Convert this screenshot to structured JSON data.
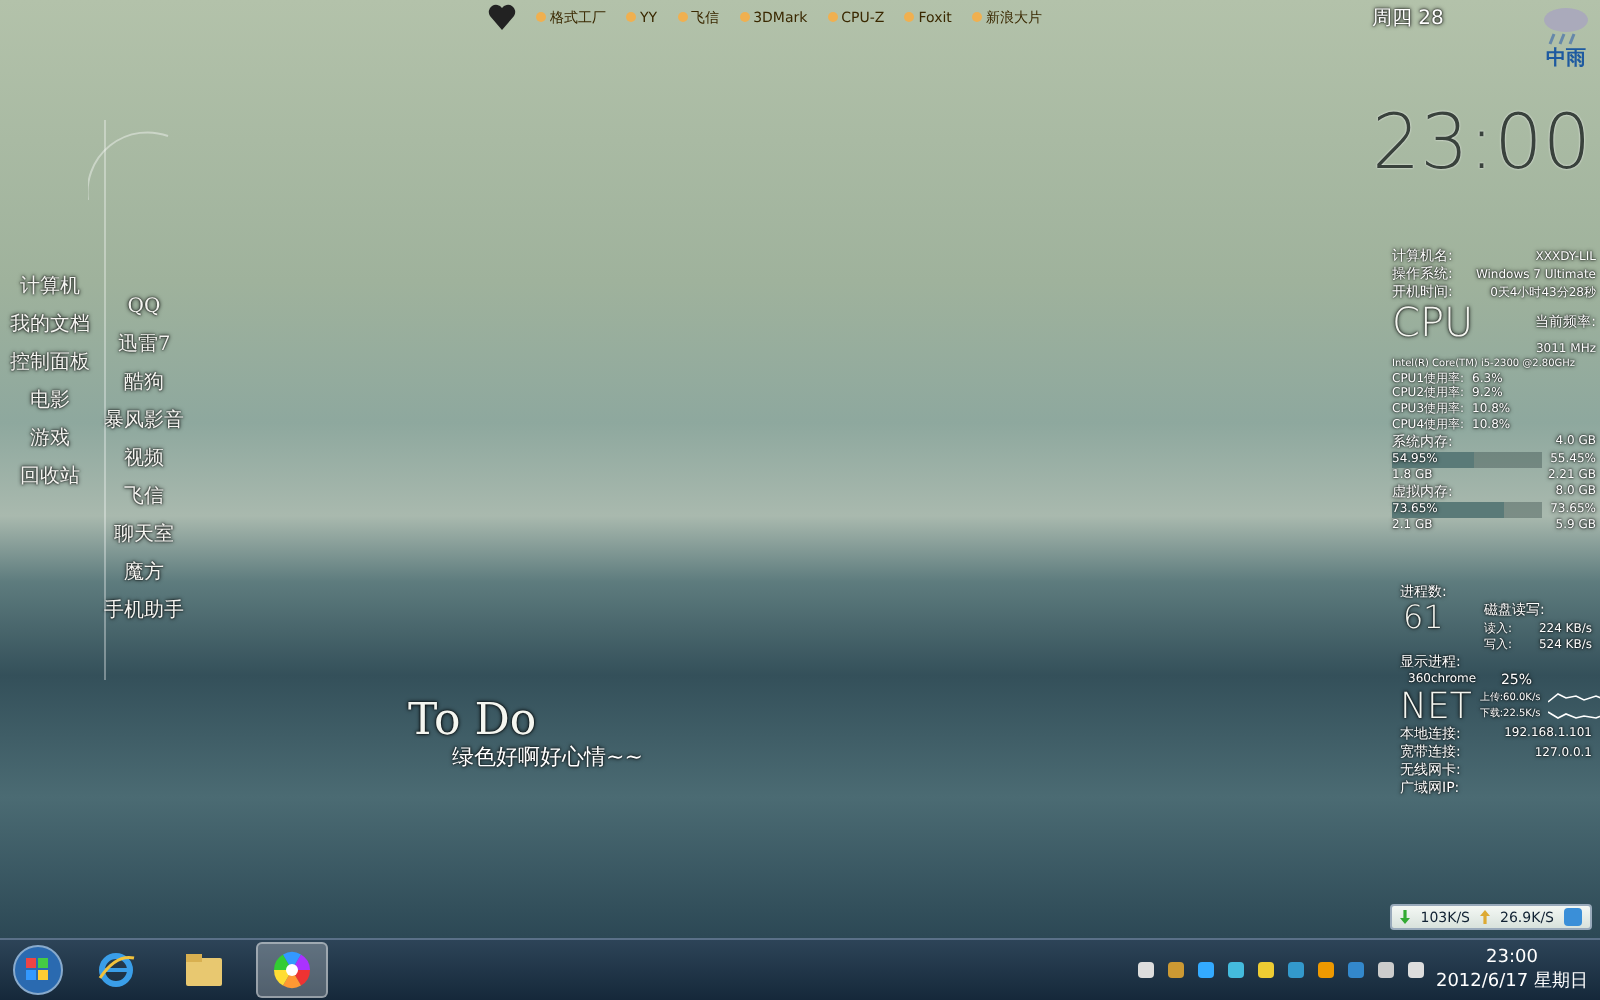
{
  "launcher": {
    "items": [
      "格式工厂",
      "YY",
      "飞信",
      "3DMark",
      "CPU-Z",
      "Foxit",
      "新浪大片"
    ]
  },
  "weather": {
    "date": "周四 28",
    "condition": "中雨",
    "time": "23:00"
  },
  "system_info": [
    {
      "label": "计算机名:",
      "value": "XXXDY-LIL"
    },
    {
      "label": "操作系统:",
      "value": "Windows 7 Ultimate"
    },
    {
      "label": "开机时间:",
      "value": "0天4小时43分28秒"
    }
  ],
  "cpu": {
    "title": "CPU",
    "freq_label": "当前频率:",
    "freq": "3011 MHz",
    "model": "Intel(R) Core(TM) i5-2300 @2.80GHz",
    "cores": [
      {
        "label": "CPU1使用率:",
        "value": "6.3%"
      },
      {
        "label": "CPU2使用率:",
        "value": "9.2%"
      },
      {
        "label": "CPU3使用率:",
        "value": "10.8%"
      },
      {
        "label": "CPU4使用率:",
        "value": "10.8%"
      }
    ]
  },
  "memory": [
    {
      "title": "系统内存:",
      "total": "4.0 GB",
      "bar_text": "54.95%",
      "usage": "55.45%",
      "level": 0.55,
      "used": "1.8 GB",
      "free": "2.21 GB"
    },
    {
      "title": "虚拟内存:",
      "total": "8.0 GB",
      "bar_text": "73.65%",
      "usage": "73.65%",
      "level": 0.74,
      "used": "2.1 GB",
      "free": "5.9 GB"
    }
  ],
  "processes": {
    "label": "进程数:",
    "count": "61",
    "disk_label": "磁盘读写:",
    "read_label": "读入:",
    "read": "224 KB/s",
    "write_label": "写入:",
    "write": "524 KB/s",
    "top_label": "显示进程:",
    "top_name": "360chrome",
    "top_usage": "25%"
  },
  "net": {
    "title": "NET",
    "upload": "上传:60.0K/s",
    "download": "下载:22.5K/s",
    "rows": [
      {
        "label": "本地连接:",
        "value": "192.168.1.101"
      },
      {
        "label": "宽带连接:",
        "value": "127.0.0.1"
      },
      {
        "label": "无线网卡:"
      },
      {
        "label": "广域网IP:"
      }
    ]
  },
  "desktop_icons_left": [
    "计算机",
    "我的文档",
    "控制面板",
    "电影",
    "游戏",
    "回收站"
  ],
  "desktop_icons_right": [
    "QQ",
    "迅雷7",
    "酷狗",
    "暴风影音",
    "视频",
    "飞信",
    "聊天室",
    "魔方",
    "手机助手"
  ],
  "note": {
    "title": "To Do",
    "text": "绿色好啊好心情~~"
  },
  "speed_meter": {
    "download": "103K/S",
    "upload": "26.9K/S"
  },
  "taskbar": {
    "apps": [
      {
        "kind": "ie",
        "selected": false
      },
      {
        "kind": "folder",
        "selected": false
      },
      {
        "kind": "media",
        "selected": true
      }
    ],
    "time": "23:00",
    "date": "2012/6/17 星期日"
  }
}
